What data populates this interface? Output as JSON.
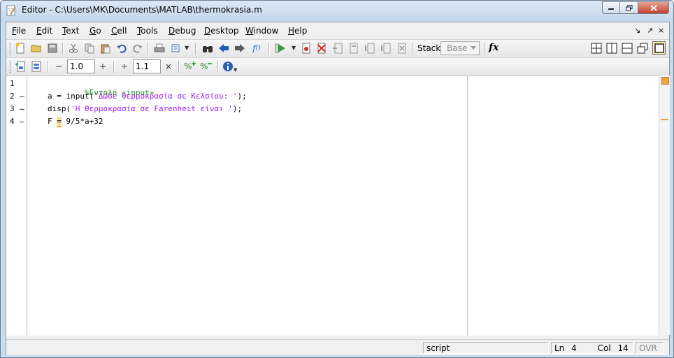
{
  "window": {
    "title": "Editor - C:\\Users\\MK\\Documents\\MATLAB\\thermokrasia.m",
    "buttons": [
      "minimize",
      "maximize",
      "close"
    ]
  },
  "menu": {
    "items": [
      "File",
      "Edit",
      "Text",
      "Go",
      "Cell",
      "Tools",
      "Debug",
      "Desktop",
      "Window",
      "Help"
    ]
  },
  "toolbar": {
    "stack_label": "Stack:",
    "stack_value": "Base",
    "fx_label": "fx"
  },
  "cell_toolbar": {
    "minus": "−",
    "increment_value": "1.0",
    "plus": "+",
    "divide": "÷",
    "multiplier_value": "1.1",
    "times": "×"
  },
  "editor": {
    "lines": [
      {
        "number": "1",
        "marker": "",
        "parts": [
          {
            "text": "%Εντολή «input»",
            "kind": "comment"
          }
        ]
      },
      {
        "number": "2",
        "marker": "–",
        "parts": [
          {
            "text": "a = input(",
            "kind": "code"
          },
          {
            "text": "'Δώσε θερμοκρασία σε Κελσίου: '",
            "kind": "string"
          },
          {
            "text": ");",
            "kind": "code"
          }
        ]
      },
      {
        "number": "3",
        "marker": "–",
        "parts": [
          {
            "text": "disp(",
            "kind": "code"
          },
          {
            "text": "'Η θερμοκρασία σε Farenheit είναι '",
            "kind": "string"
          },
          {
            "text": ");",
            "kind": "code"
          }
        ]
      },
      {
        "number": "4",
        "marker": "–",
        "parts": [
          {
            "text": "F ",
            "kind": "code"
          },
          {
            "text": "=",
            "kind": "warning"
          },
          {
            "text": " 9/5*a+32",
            "kind": "code"
          }
        ]
      }
    ]
  },
  "status": {
    "mode": "script",
    "ln_label": "Ln",
    "ln_value": "4",
    "col_label": "Col",
    "col_value": "14",
    "ovr": "OVR"
  },
  "colors": {
    "comment": "#228b22",
    "string": "#a020f0",
    "warning_marker": "#f0a33b"
  }
}
